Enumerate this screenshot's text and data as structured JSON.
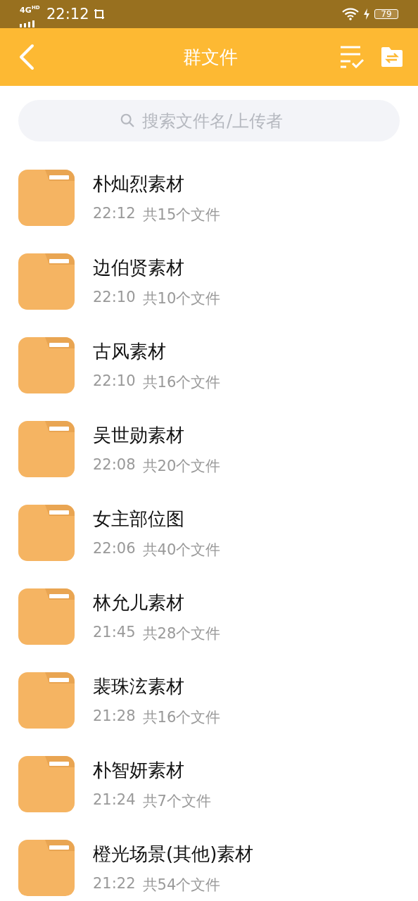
{
  "status_bar": {
    "network": "4G",
    "network_sub": "HD",
    "time": "22:12",
    "battery": "79"
  },
  "header": {
    "title": "群文件"
  },
  "search": {
    "placeholder": "搜索文件名/上传者"
  },
  "folders": [
    {
      "name": "朴灿烈素材",
      "time": "22:12",
      "count": "共15个文件"
    },
    {
      "name": "边伯贤素材",
      "time": "22:10",
      "count": "共10个文件"
    },
    {
      "name": "古风素材",
      "time": "22:10",
      "count": "共16个文件"
    },
    {
      "name": "吴世勋素材",
      "time": "22:08",
      "count": "共20个文件"
    },
    {
      "name": "女主部位图",
      "time": "22:06",
      "count": "共40个文件"
    },
    {
      "name": "林允儿素材",
      "time": "21:45",
      "count": "共28个文件"
    },
    {
      "name": "裴珠泫素材",
      "time": "21:28",
      "count": "共16个文件"
    },
    {
      "name": "朴智妍素材",
      "time": "21:24",
      "count": "共7个文件"
    },
    {
      "name": "橙光场景(其他)素材",
      "time": "21:22",
      "count": "共54个文件"
    }
  ]
}
